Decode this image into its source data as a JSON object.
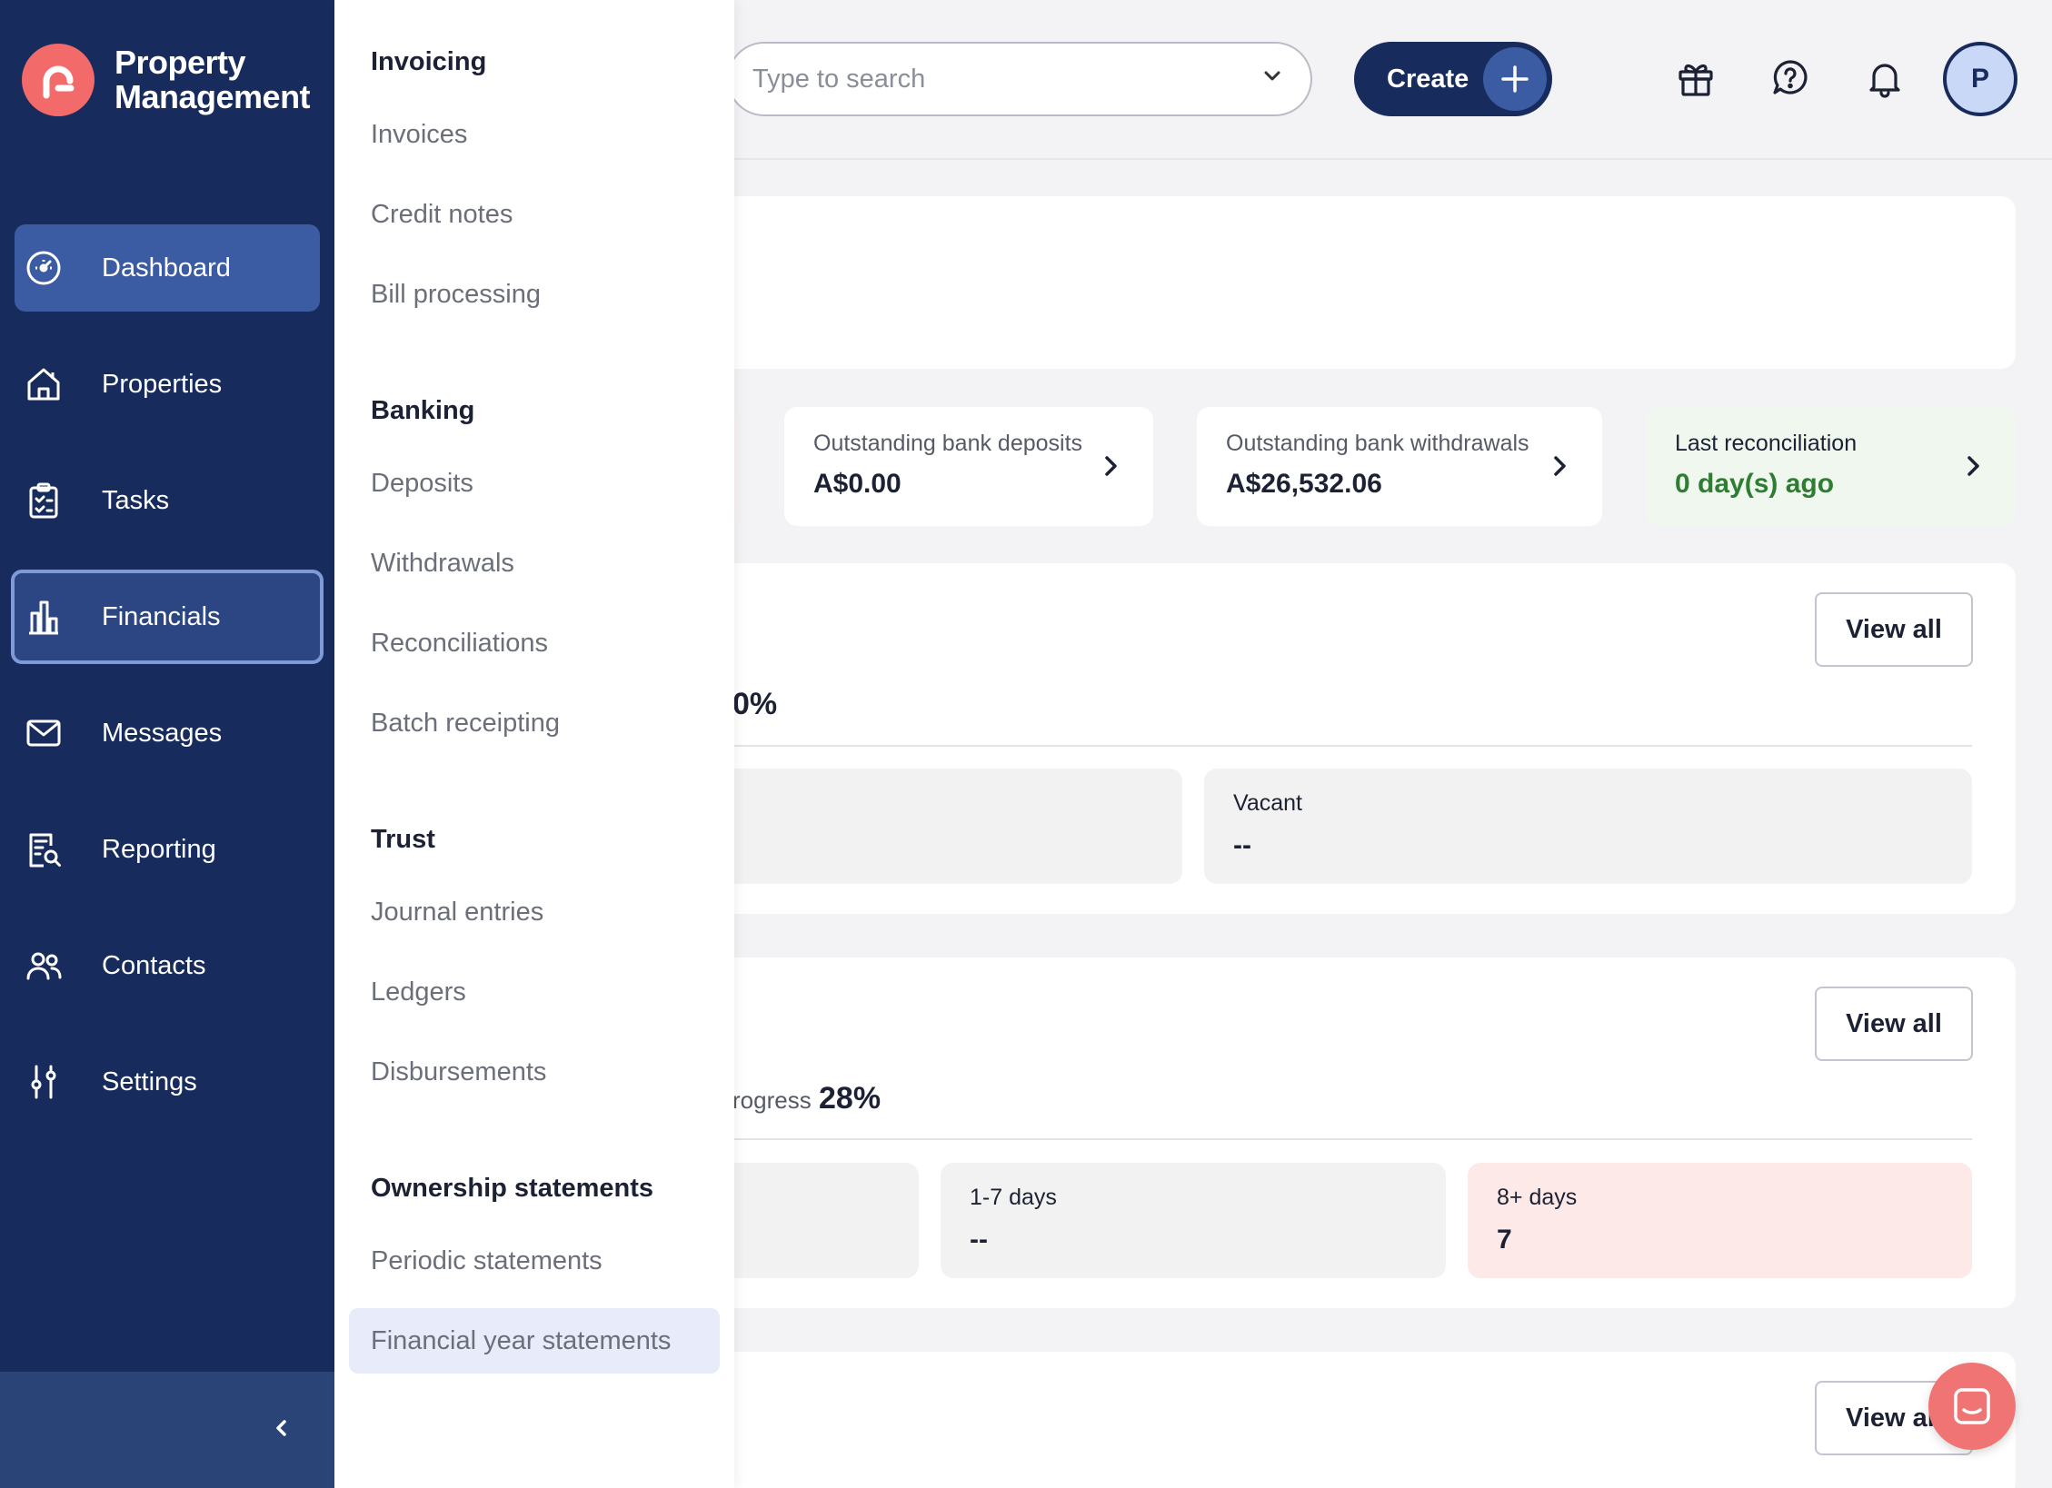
{
  "brand": {
    "line1": "Property",
    "line2": "Management"
  },
  "sidebar": {
    "items": [
      {
        "label": "Dashboard"
      },
      {
        "label": "Properties"
      },
      {
        "label": "Tasks"
      },
      {
        "label": "Financials"
      },
      {
        "label": "Messages"
      },
      {
        "label": "Reporting"
      },
      {
        "label": "Contacts"
      },
      {
        "label": "Settings"
      }
    ]
  },
  "submenu": {
    "sections": [
      {
        "title": "Invoicing",
        "items": [
          "Invoices",
          "Credit notes",
          "Bill processing"
        ]
      },
      {
        "title": "Banking",
        "items": [
          "Deposits",
          "Withdrawals",
          "Reconciliations",
          "Batch receipting"
        ]
      },
      {
        "title": "Trust",
        "items": [
          "Journal entries",
          "Ledgers",
          "Disbursements"
        ]
      },
      {
        "title": "Ownership statements",
        "items": [
          "Periodic statements",
          "Financial year statements"
        ]
      }
    ]
  },
  "topbar": {
    "search_placeholder": "Type to search",
    "create_label": "Create",
    "avatar_initial": "P"
  },
  "stats": [
    {
      "title": "Outstanding bank deposits",
      "value": "A$0.00"
    },
    {
      "title": "Outstanding bank withdrawals",
      "value": "A$26,532.06"
    },
    {
      "title": "Last reconciliation",
      "value": "0 day(s) ago"
    }
  ],
  "section1": {
    "view_all": "View all",
    "percent_fragment": "0%",
    "tiles": [
      {
        "title": "Vacant",
        "value": "--"
      }
    ]
  },
  "section2": {
    "view_all": "View all",
    "progress_fragment": "rogress",
    "percent": "28%",
    "tiles": [
      {
        "title": "1-7 days",
        "value": "--"
      },
      {
        "title": "8+ days",
        "value": "7"
      }
    ]
  },
  "section3": {
    "view_all": "View all"
  },
  "colors": {
    "sidebar": "#172b5c",
    "accent": "#f26a6a",
    "active": "#3b5ba3",
    "success": "#2e7d32",
    "danger_bg": "#fce9e8"
  }
}
